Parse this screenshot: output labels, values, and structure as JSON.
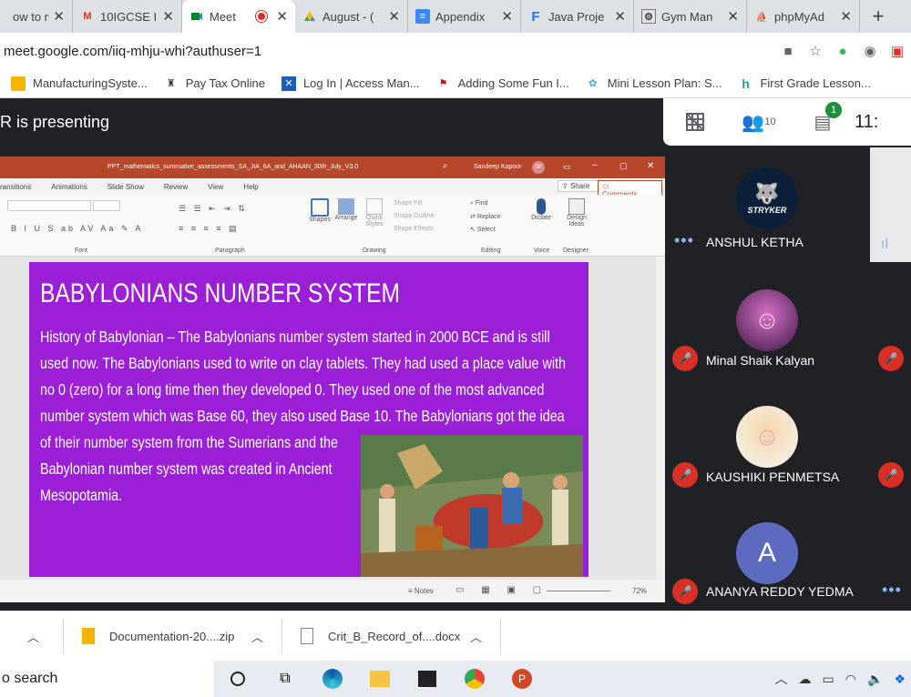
{
  "browser": {
    "tabs": [
      {
        "title": "ow to ru",
        "icon": "page-icon"
      },
      {
        "title": "10IGCSE I",
        "icon": "gmail-icon"
      },
      {
        "title": "Meet",
        "icon": "meet-icon",
        "active": true
      },
      {
        "title": "August - (",
        "icon": "drive-icon"
      },
      {
        "title": "Appendix",
        "icon": "docs-icon"
      },
      {
        "title": "Java Proje",
        "icon": "f-icon"
      },
      {
        "title": "Gym Man",
        "icon": "gym-icon"
      },
      {
        "title": "phpMyAd",
        "icon": "phpmyadmin-icon"
      }
    ],
    "url": "meet.google.com/iiq-mhju-whi?authuser=1",
    "bookmarks": [
      {
        "label": "ManufacturingSyste...",
        "icon": "folder-icon"
      },
      {
        "label": "Pay Tax Online",
        "icon": "emblem-icon"
      },
      {
        "label": "Log In | Access Man...",
        "icon": "access-icon"
      },
      {
        "label": "Adding Some Fun I...",
        "icon": "flag-icon"
      },
      {
        "label": "Mini Lesson Plan: S...",
        "icon": "gear-outline-icon"
      },
      {
        "label": "First Grade Lesson...",
        "icon": "h-icon"
      }
    ]
  },
  "meet": {
    "presenting_label": "R is presenting",
    "participants_count": "10",
    "chat_badge": "1",
    "time_partial": "11:",
    "participants": [
      {
        "name": "ANSHUL KETHA",
        "avatar": "STRYKER",
        "muted": false
      },
      {
        "name": "Minal Shaik Kalyan",
        "avatar": "photo",
        "muted": true
      },
      {
        "name": "KAUSHIKI PENMETSA",
        "avatar": "photo",
        "muted": true
      },
      {
        "name": "ANANYA REDDY YEDMA",
        "avatar": "A",
        "muted": true
      }
    ]
  },
  "ppt": {
    "file_title": "PPT_mathematics_summative_assessments_SA_JIA_6A_and_AHAAN_30th_July_V3.0",
    "user": "Sandeep Kapoor",
    "user_initials": "SK",
    "tabs": [
      "ransitions",
      "Animations",
      "Slide Show",
      "Review",
      "View",
      "Help"
    ],
    "share": "Share",
    "comments": "Comments",
    "groups": {
      "font": "Font",
      "paragraph": "Paragraph",
      "drawing": "Drawing",
      "editing": "Editing",
      "voice": "Voice",
      "designer": "Designer"
    },
    "ribbon_items": {
      "shapes": "Shapes",
      "arrange": "Arrange",
      "quick_styles": "Quick Styles",
      "shape_fill": "Shape Fill",
      "shape_outline": "Shape Outline",
      "shape_effects": "Shape Effects",
      "find": "Find",
      "replace": "Replace",
      "select": "Select",
      "dictate": "Dictate",
      "design_ideas": "Design Ideas"
    },
    "slide": {
      "title": "BABYLONIANS NUMBER SYSTEM",
      "body_lines": [
        "History of Babylonian – The Babylonians number system started in 2000 BCE and is still",
        "used now. The Babylonians used to write on clay tablets. They had used a place value with",
        "no 0 (zero) for a long time then they developed 0. They used one of the most advanced",
        "number system which was Base 60, they also used Base 10. The Babylonians got the idea",
        "of their number system from the Sumerians and the",
        "Babylonian number system was created in Ancient",
        "Mesopotamia."
      ]
    },
    "notes": "Notes",
    "zoom": "72%"
  },
  "downloads": [
    {
      "name": "Documentation-20....zip",
      "icon": "zip-icon"
    },
    {
      "name": "Crit_B_Record_of....docx",
      "icon": "doc-icon"
    }
  ],
  "taskbar": {
    "search_text": "o search"
  },
  "colors": {
    "slide_bg": "#9b1fd6",
    "ppt_accent": "#b7472a",
    "meet_bg": "#202124",
    "mute_red": "#d93025",
    "chat_green": "#1e8e3e"
  }
}
